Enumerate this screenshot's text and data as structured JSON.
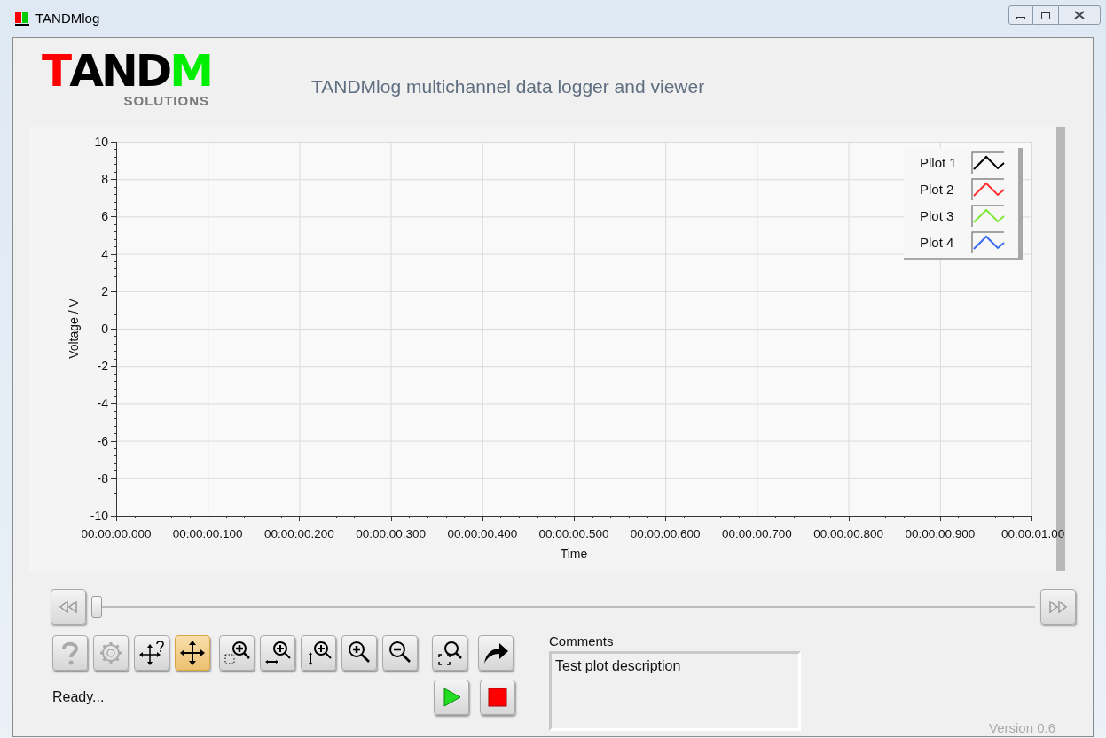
{
  "window": {
    "title": "TANDMlog"
  },
  "logo": {
    "parts": [
      {
        "text": "T",
        "color": "#ff0000"
      },
      {
        "text": "AND",
        "color": "#000000"
      },
      {
        "text": "M",
        "color": "#00ee00"
      }
    ],
    "subtitle": "SOLUTIONS"
  },
  "heading": "TANDMlog multichannel data logger and viewer",
  "chart": {
    "chart_data": {
      "type": "line",
      "xlabel": "Time",
      "ylabel": "Voltage / V",
      "grid": true,
      "ylim": [
        -10,
        10
      ],
      "yticks": [
        10,
        8,
        6,
        4,
        2,
        0,
        -2,
        -4,
        -6,
        -8,
        -10
      ],
      "categories": [
        "00:00:00.000",
        "00:00:00.100",
        "00:00:00.200",
        "00:00:00.300",
        "00:00:00.400",
        "00:00:00.500",
        "00:00:00.600",
        "00:00:00.700",
        "00:00:00.800",
        "00:00:00.900",
        "00:00:01.00"
      ]
    },
    "legend": [
      {
        "name": "Pllot 1",
        "color": "#000000"
      },
      {
        "name": "Plot 2",
        "color": "#ff3030"
      },
      {
        "name": "Plot 3",
        "color": "#7ee83a"
      },
      {
        "name": "Plot 4",
        "color": "#3a6ef0"
      }
    ]
  },
  "slider": {
    "level": 0
  },
  "tools": [
    {
      "kind": "help",
      "selected": false,
      "disabled": true
    },
    {
      "kind": "settings",
      "selected": false,
      "disabled": true
    },
    {
      "kind": "pan-help",
      "selected": false,
      "disabled": false
    },
    {
      "kind": "pan",
      "selected": true,
      "disabled": false
    },
    {
      "kind": "zoom-rect",
      "selected": false,
      "disabled": false
    },
    {
      "kind": "zoom-x",
      "selected": false,
      "disabled": false
    },
    {
      "kind": "zoom-y",
      "selected": false,
      "disabled": false
    },
    {
      "kind": "zoom-in",
      "selected": false,
      "disabled": false
    },
    {
      "kind": "zoom-out",
      "selected": false,
      "disabled": false
    },
    {
      "kind": "zoom-fit",
      "selected": false,
      "disabled": false
    },
    {
      "kind": "export",
      "selected": false,
      "disabled": false
    }
  ],
  "status": "Ready...",
  "run_buttons": [
    {
      "kind": "play"
    },
    {
      "kind": "stop"
    }
  ],
  "comments": {
    "label": "Comments",
    "value": "Test plot description"
  },
  "version": "Version 0.6"
}
